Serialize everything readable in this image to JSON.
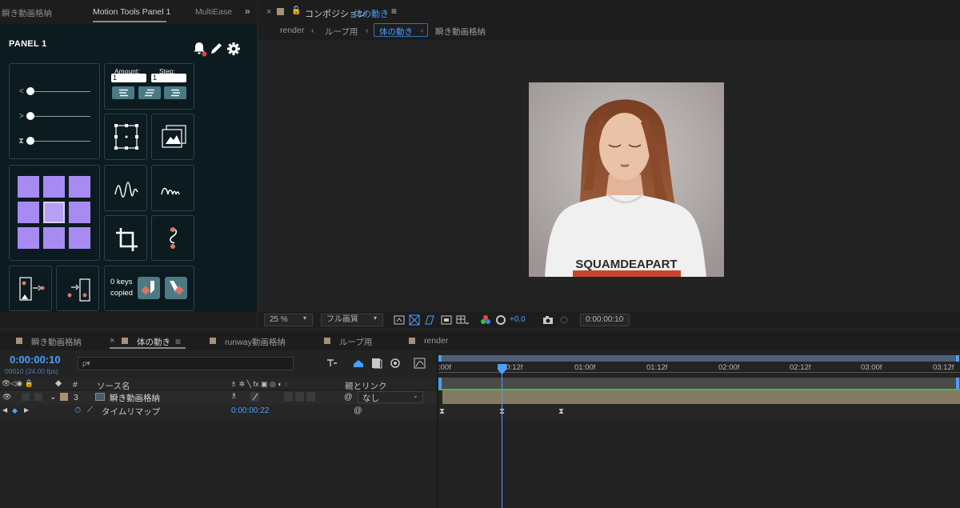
{
  "left_panel": {
    "tabs": [
      {
        "label": "瞬き動画格納"
      },
      {
        "label": "Motion Tools Panel 1"
      },
      {
        "label": "MultiEase"
      }
    ],
    "overflow_icon": "double-chevron-right-icon",
    "title": "PANEL 1",
    "header_icons": [
      "bell-icon",
      "pencil-icon",
      "gear-icon"
    ],
    "sliders": [
      {
        "label": "<"
      },
      {
        "label": ">"
      },
      {
        "label": "⧗"
      }
    ],
    "amount_label": "Amount:",
    "amount_value": "1",
    "step_label": "Step:",
    "step_value": "1",
    "align_icons": [
      "align-left-icon",
      "align-center-icon",
      "align-right-icon"
    ],
    "keys_copied_text": "0 keys",
    "keys_copied_text2": "copied",
    "colors": {
      "accent": "#a78bf3",
      "panel_bg": "#0c1b20",
      "button": "#4b7a85",
      "key_dot": "#e0735f"
    }
  },
  "comp": {
    "tab_label": "コンポジション",
    "comp_name": "体の動き",
    "breadcrumbs": [
      "render",
      "ループ用",
      "体の動き",
      "瞬き動画格納"
    ],
    "photo_shirt_text": "SQUAMDEAPART",
    "zoom": "25 %",
    "quality": "フル画質",
    "exposure": "+0.0",
    "current_time": "0:00:00:10"
  },
  "timeline": {
    "tabs": [
      {
        "label": "瞬き動画格納"
      },
      {
        "label": "体の動き"
      },
      {
        "label": "runway動画格納"
      },
      {
        "label": "ループ用"
      },
      {
        "label": "render"
      }
    ],
    "timecode": "0:00:00:10",
    "fps": "00010 (24.00 fps)",
    "search_placeholder": "ρ▾",
    "col_source": "ソース名",
    "col_parent": "親とリンク",
    "col_hash": "#",
    "layer": {
      "number": "3",
      "name": "瞬き動画格納",
      "parent": "なし"
    },
    "property": {
      "name": "タイムリマップ",
      "value": "0:00:00:22"
    },
    "ruler": [
      ":00f",
      "00:12f",
      "01:00f",
      "01:12f",
      "02:00f",
      "02:12f",
      "03:00f",
      "03:12f"
    ],
    "keyframe_times": [
      "0:00:00:00",
      "0:00:00:10",
      "0:00:00:22"
    ]
  }
}
